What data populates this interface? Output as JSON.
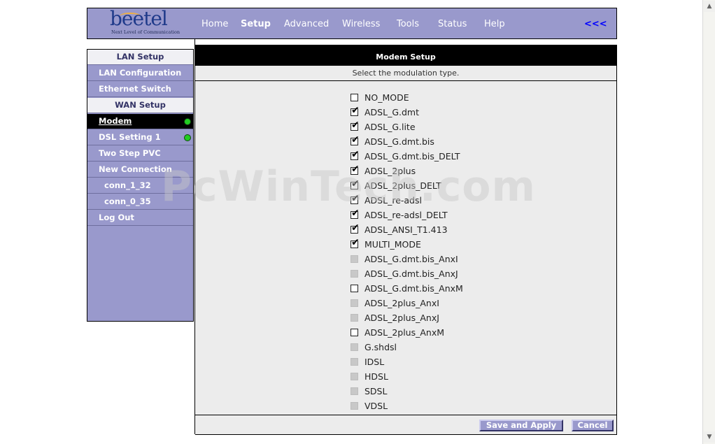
{
  "header": {
    "logo_text": "beetel",
    "logo_tagline": "Next Level of Communication",
    "nav": [
      "Home",
      "Setup",
      "Advanced",
      "Wireless",
      "Tools",
      "Status",
      "Help"
    ],
    "active_nav": "Setup",
    "collapse_label": "<<<"
  },
  "sidebar": {
    "items": [
      {
        "label": "LAN Setup",
        "type": "section"
      },
      {
        "label": "LAN Configuration",
        "type": "link"
      },
      {
        "label": "Ethernet Switch",
        "type": "link"
      },
      {
        "label": "WAN Setup",
        "type": "section"
      },
      {
        "label": "Modem",
        "type": "active",
        "status": "green"
      },
      {
        "label": "DSL Setting 1",
        "type": "link",
        "status": "green"
      },
      {
        "label": "Two Step PVC",
        "type": "link"
      },
      {
        "label": "New Connection",
        "type": "link"
      },
      {
        "label": "conn_1_32",
        "type": "sub"
      },
      {
        "label": "conn_0_35",
        "type": "sub"
      },
      {
        "label": "Log Out",
        "type": "link"
      }
    ]
  },
  "main": {
    "title": "Modem Setup",
    "subtitle": "Select the modulation type.",
    "options": [
      {
        "label": "NO_MODE",
        "checked": false,
        "disabled": false
      },
      {
        "label": "ADSL_G.dmt",
        "checked": true,
        "disabled": false
      },
      {
        "label": "ADSL_G.lite",
        "checked": true,
        "disabled": false
      },
      {
        "label": "ADSL_G.dmt.bis",
        "checked": true,
        "disabled": false
      },
      {
        "label": "ADSL_G.dmt.bis_DELT",
        "checked": true,
        "disabled": false
      },
      {
        "label": "ADSL_2plus",
        "checked": true,
        "disabled": false
      },
      {
        "label": "ADSL_2plus_DELT",
        "checked": true,
        "disabled": false
      },
      {
        "label": "ADSL_re-adsl",
        "checked": true,
        "disabled": false
      },
      {
        "label": "ADSL_re-adsl_DELT",
        "checked": true,
        "disabled": false
      },
      {
        "label": "ADSL_ANSI_T1.413",
        "checked": true,
        "disabled": false
      },
      {
        "label": "MULTI_MODE",
        "checked": true,
        "disabled": false
      },
      {
        "label": "ADSL_G.dmt.bis_AnxI",
        "checked": false,
        "disabled": true
      },
      {
        "label": "ADSL_G.dmt.bis_AnxJ",
        "checked": false,
        "disabled": true
      },
      {
        "label": "ADSL_G.dmt.bis_AnxM",
        "checked": false,
        "disabled": false
      },
      {
        "label": "ADSL_2plus_AnxI",
        "checked": false,
        "disabled": true
      },
      {
        "label": "ADSL_2plus_AnxJ",
        "checked": false,
        "disabled": true
      },
      {
        "label": "ADSL_2plus_AnxM",
        "checked": false,
        "disabled": false
      },
      {
        "label": "G.shdsl",
        "checked": false,
        "disabled": true
      },
      {
        "label": "IDSL",
        "checked": false,
        "disabled": true
      },
      {
        "label": "HDSL",
        "checked": false,
        "disabled": true
      },
      {
        "label": "SDSL",
        "checked": false,
        "disabled": true
      },
      {
        "label": "VDSL",
        "checked": false,
        "disabled": true
      }
    ],
    "save_label": "Save and Apply",
    "cancel_label": "Cancel"
  },
  "watermark": "PcWinTech.com",
  "colors": {
    "panel": "#9999cc",
    "bar": "#000000",
    "content_bg": "#ececec",
    "status_dot": "#22cc22"
  }
}
